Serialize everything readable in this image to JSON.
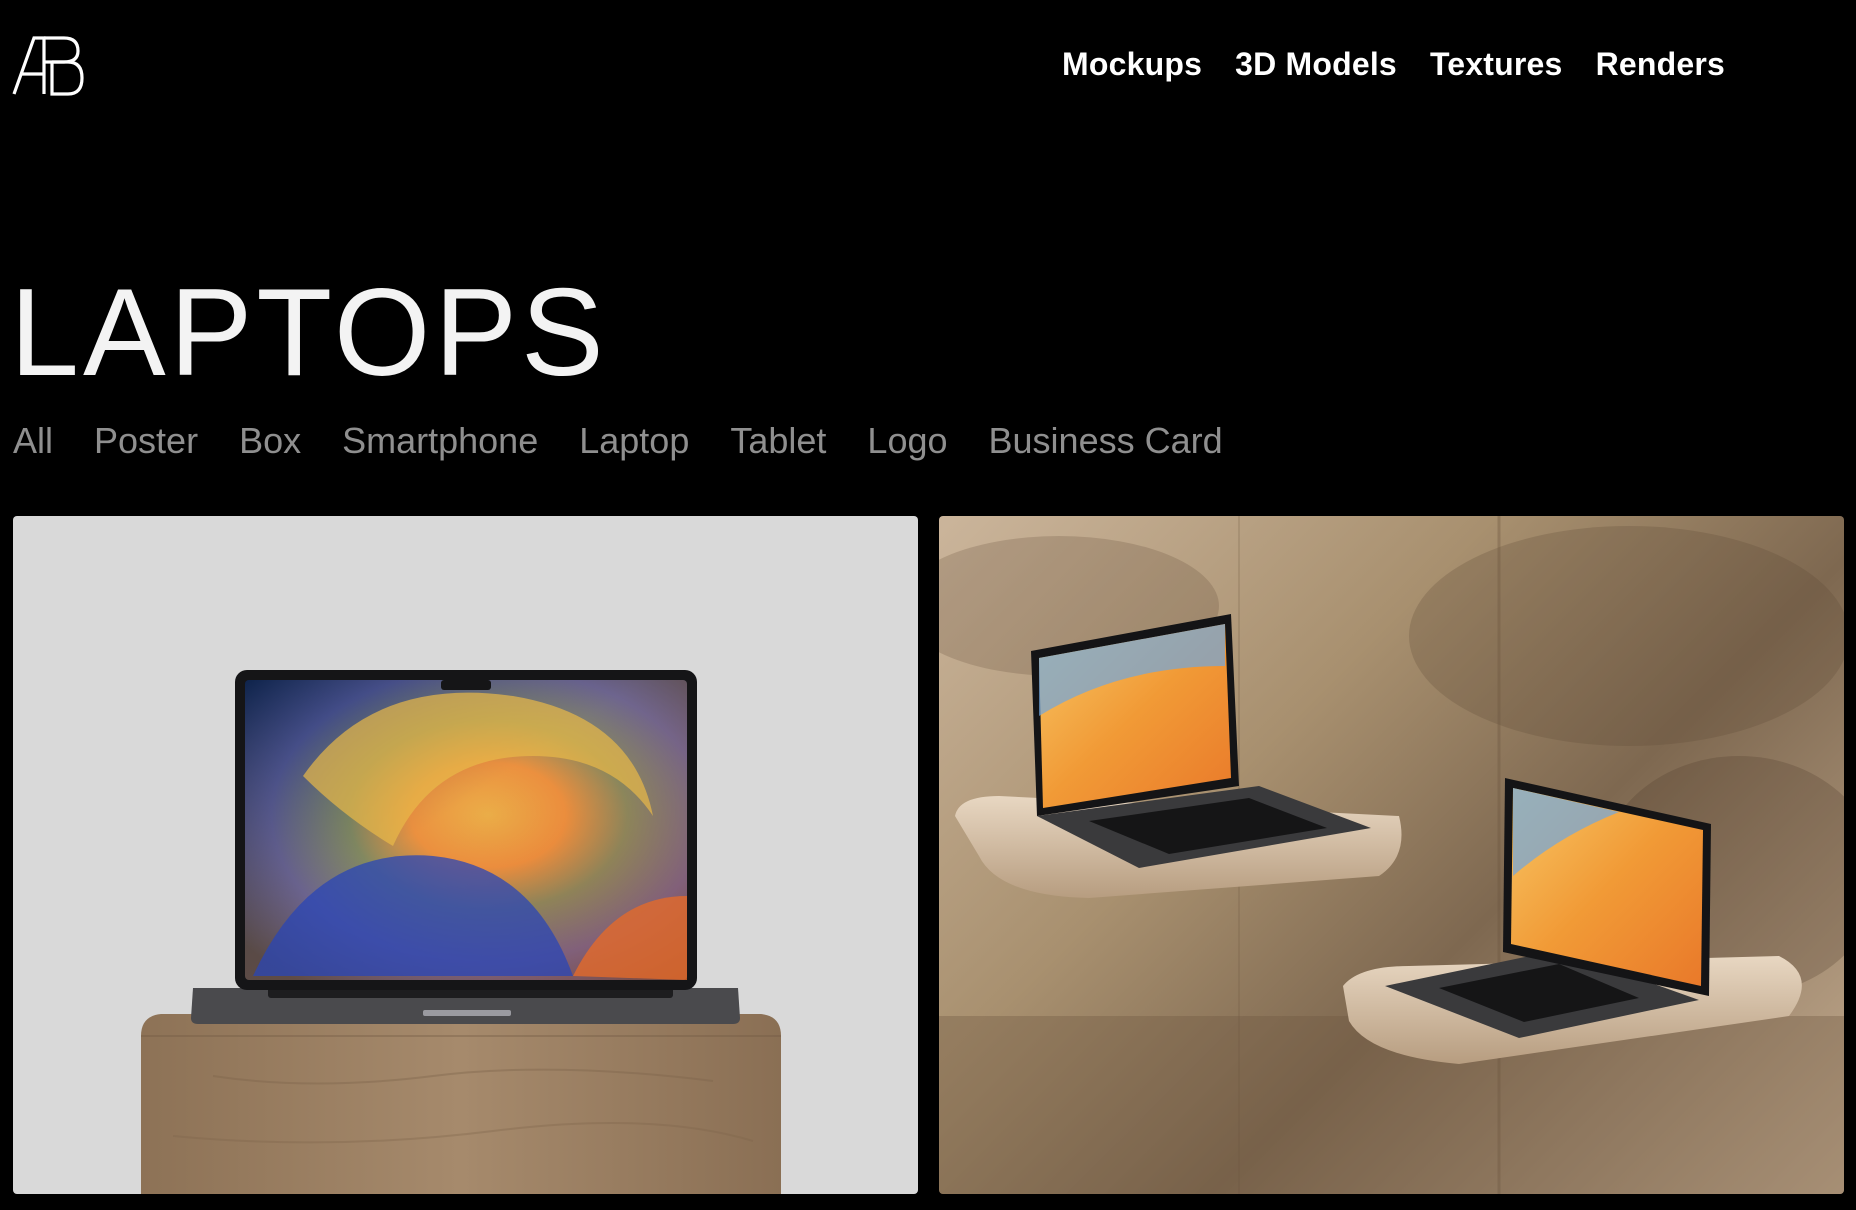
{
  "header": {
    "logo_name": "AB",
    "nav": [
      {
        "label": "Mockups"
      },
      {
        "label": "3D Models"
      },
      {
        "label": "Textures"
      },
      {
        "label": "Renders"
      }
    ]
  },
  "page": {
    "title": "LAPTOPS"
  },
  "filters": [
    {
      "label": "All"
    },
    {
      "label": "Poster"
    },
    {
      "label": "Box"
    },
    {
      "label": "Smartphone"
    },
    {
      "label": "Laptop"
    },
    {
      "label": "Tablet"
    },
    {
      "label": "Logo"
    },
    {
      "label": "Business Card"
    }
  ],
  "colors": {
    "background": "#000000",
    "text_primary": "#ffffff",
    "text_muted": "#8f8f8f",
    "card_1_bg": "#d9d9d9"
  },
  "cards": [
    {
      "image_icon": "laptop-on-wooden-pedestal-image"
    },
    {
      "image_icon": "two-laptops-on-wall-shelves-image"
    }
  ]
}
